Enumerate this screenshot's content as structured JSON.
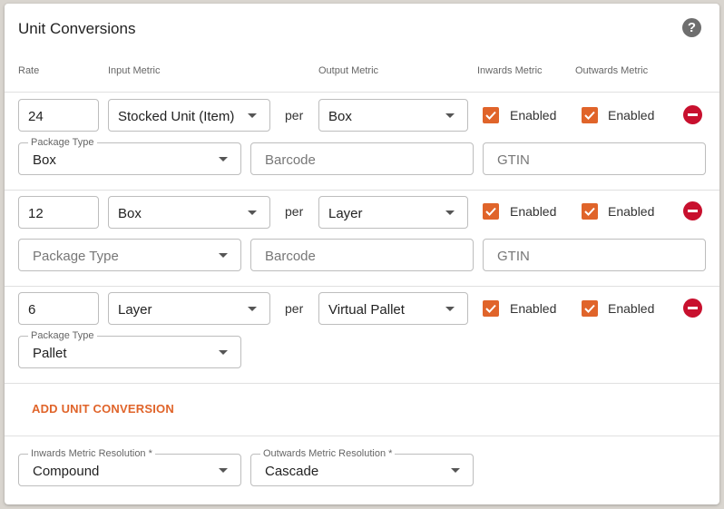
{
  "title": "Unit Conversions",
  "help_icon": "help-circle-icon",
  "columns": {
    "rate": "Rate",
    "input_metric": "Input Metric",
    "output_metric": "Output Metric",
    "inwards_metric": "Inwards Metric",
    "outwards_metric": "Outwards Metric"
  },
  "per_label": "per",
  "rows": [
    {
      "rate": "24",
      "input": "Stocked Unit (Item)",
      "output": "Box",
      "inwards_label": "Enabled",
      "inwards_checked": true,
      "outwards_label": "Enabled",
      "outwards_checked": true,
      "package_type_legend": "Package Type",
      "package_type": "Box",
      "barcode_placeholder": "Barcode",
      "gtin_placeholder": "GTIN"
    },
    {
      "rate": "12",
      "input": "Box",
      "output": "Layer",
      "inwards_label": "Enabled",
      "inwards_checked": true,
      "outwards_label": "Enabled",
      "outwards_checked": true,
      "package_type_placeholder": "Package Type",
      "barcode_placeholder": "Barcode",
      "gtin_placeholder": "GTIN"
    },
    {
      "rate": "6",
      "input": "Layer",
      "output": "Virtual Pallet",
      "inwards_label": "Enabled",
      "inwards_checked": true,
      "outwards_label": "Enabled",
      "outwards_checked": true,
      "package_type_legend": "Package Type",
      "package_type": "Pallet"
    }
  ],
  "add_button": "ADD UNIT CONVERSION",
  "resolution": {
    "inwards_legend": "Inwards Metric Resolution *",
    "inwards_value": "Compound",
    "outwards_legend": "Outwards Metric Resolution *",
    "outwards_value": "Cascade"
  },
  "colors": {
    "accent": "#e0642a",
    "remove": "#c8102e"
  }
}
